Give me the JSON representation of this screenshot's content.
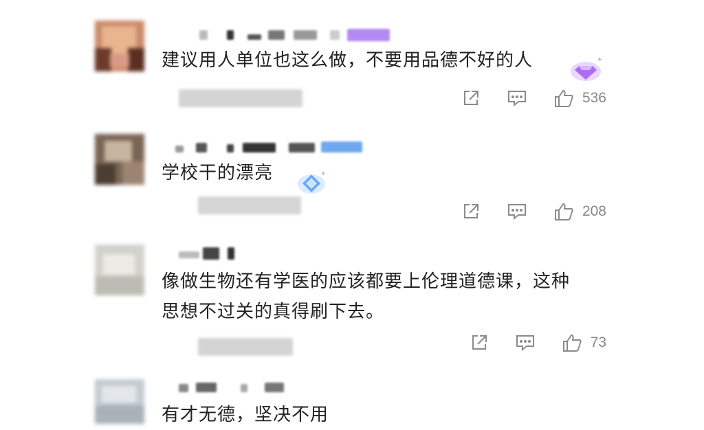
{
  "comments": [
    {
      "text": "建议用人单位也这么做，不要用品德不好的人",
      "likes": "536",
      "badge_color": "#b06cf0",
      "badge_icon": "diamond-badge-icon"
    },
    {
      "text": "学校干的漂亮",
      "likes": "208",
      "badge_color": "#6aa8f5",
      "badge_icon": "diamond-badge-icon"
    },
    {
      "text_lines": [
        "像做生物还有学医的应该都要上伦理道德课，这种",
        "思想不过关的真得刷下去。"
      ],
      "likes": "73"
    },
    {
      "text": "有才无德，坚决不用"
    }
  ],
  "icons": {
    "share": "share-icon",
    "reply": "comment-icon",
    "like": "thumbs-up-icon"
  }
}
